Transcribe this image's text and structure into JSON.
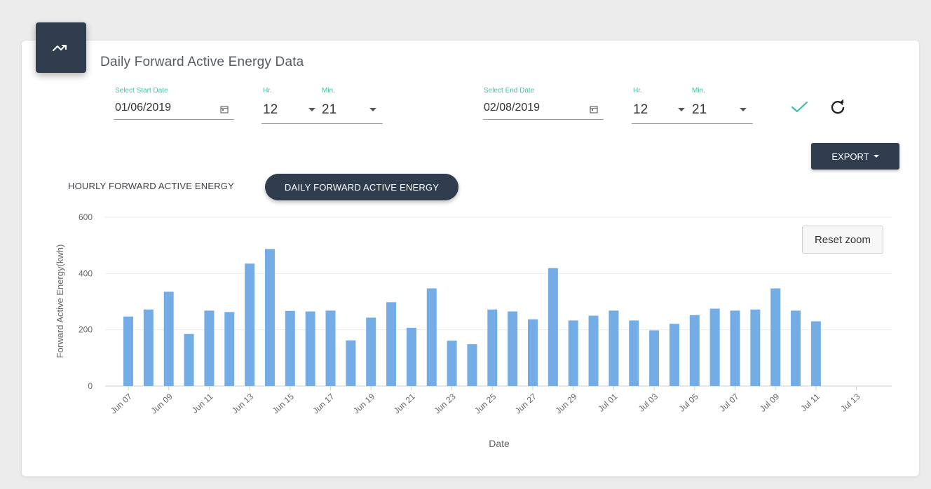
{
  "header": {
    "title": "Daily Forward Active Energy Data"
  },
  "start": {
    "label": "Select Start Date",
    "date": "01/06/2019",
    "hr_label": "Hr.",
    "hr": "12",
    "min_label": "Min.",
    "min": "21"
  },
  "end": {
    "label": "Select End Date",
    "date": "02/08/2019",
    "hr_label": "Hr.",
    "hr": "12",
    "min_label": "Min.",
    "min": "21"
  },
  "toolbar": {
    "export_label": "EXPORT",
    "reset_zoom_label": "Reset zoom"
  },
  "tabs": [
    {
      "label": "HOURLY FORWARD ACTIVE ENERGY",
      "active": false
    },
    {
      "label": "DAILY FORWARD ACTIVE ENERGY",
      "active": true
    }
  ],
  "icons": {
    "card": "trend-icon",
    "calendar": "calendar-icon",
    "apply": "check-icon",
    "refresh": "refresh-icon"
  },
  "colors": {
    "accent": "#2f3d4f",
    "bar": "#74ade6",
    "label_teal": "#3fbfa8",
    "check": "#3fbfa8"
  },
  "chart_data": {
    "type": "bar",
    "xlabel": "Date",
    "ylabel": "Forward Active Energy(kwh)",
    "ylim": [
      0,
      600
    ],
    "yticks": [
      0,
      200,
      400,
      600
    ],
    "grid": true,
    "x_tick_labels": [
      "Jun 07",
      "Jun 09",
      "Jun 11",
      "Jun 13",
      "Jun 15",
      "Jun 17",
      "Jun 19",
      "Jun 21",
      "Jun 23",
      "Jun 25",
      "Jun 27",
      "Jun 29",
      "Jul 01",
      "Jul 03",
      "Jul 05",
      "Jul 07",
      "Jul 09",
      "Jul 11",
      "Jul 13"
    ],
    "categories": [
      "Jun 07",
      "Jun 08",
      "Jun 09",
      "Jun 10",
      "Jun 11",
      "Jun 12",
      "Jun 13",
      "Jun 14",
      "Jun 15",
      "Jun 16",
      "Jun 17",
      "Jun 18",
      "Jun 19",
      "Jun 20",
      "Jun 21",
      "Jun 22",
      "Jun 23",
      "Jun 24",
      "Jun 25",
      "Jun 26",
      "Jun 27",
      "Jun 28",
      "Jun 29",
      "Jun 30",
      "Jul 01",
      "Jul 02",
      "Jul 03",
      "Jul 04",
      "Jul 05",
      "Jul 06",
      "Jul 07",
      "Jul 08",
      "Jul 09",
      "Jul 10",
      "Jul 11"
    ],
    "values": [
      247,
      272,
      335,
      185,
      268,
      263,
      435,
      487,
      267,
      265,
      268,
      162,
      243,
      298,
      207,
      347,
      161,
      149,
      272,
      265,
      237,
      419,
      233,
      250,
      268,
      233,
      198,
      221,
      252,
      275,
      268,
      272,
      347,
      268,
      230
    ]
  }
}
